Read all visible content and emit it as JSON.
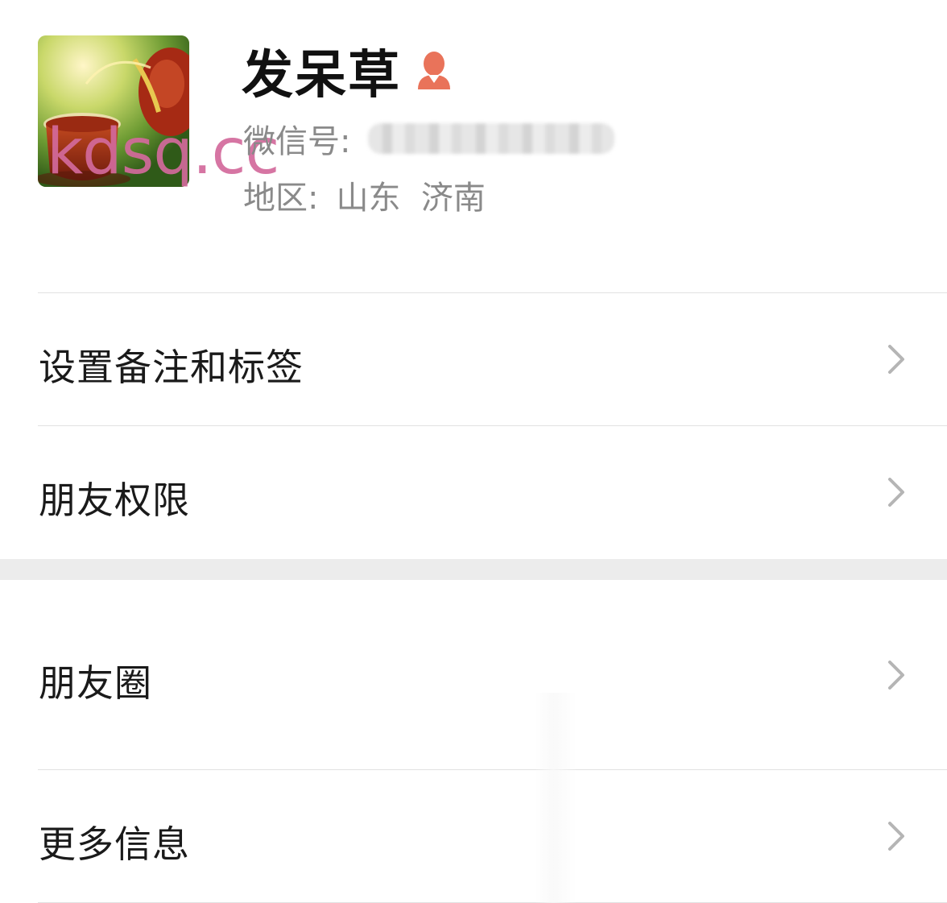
{
  "profile": {
    "name": "发呆草",
    "gender_icon": "female-person-icon",
    "gender_icon_color": "#e9735a",
    "wechat_id_label": "微信号:",
    "region_label": "地区:",
    "region_value": "山东  济南",
    "watermark": "kdsq.cc"
  },
  "menu": {
    "remark_tags": "设置备注和标签",
    "friend_permissions": "朋友权限",
    "moments": "朋友圈",
    "more_info": "更多信息"
  },
  "colors": {
    "chevron": "#b5b5b5",
    "section_gap": "#ececec",
    "divider": "#e2e2e2"
  }
}
